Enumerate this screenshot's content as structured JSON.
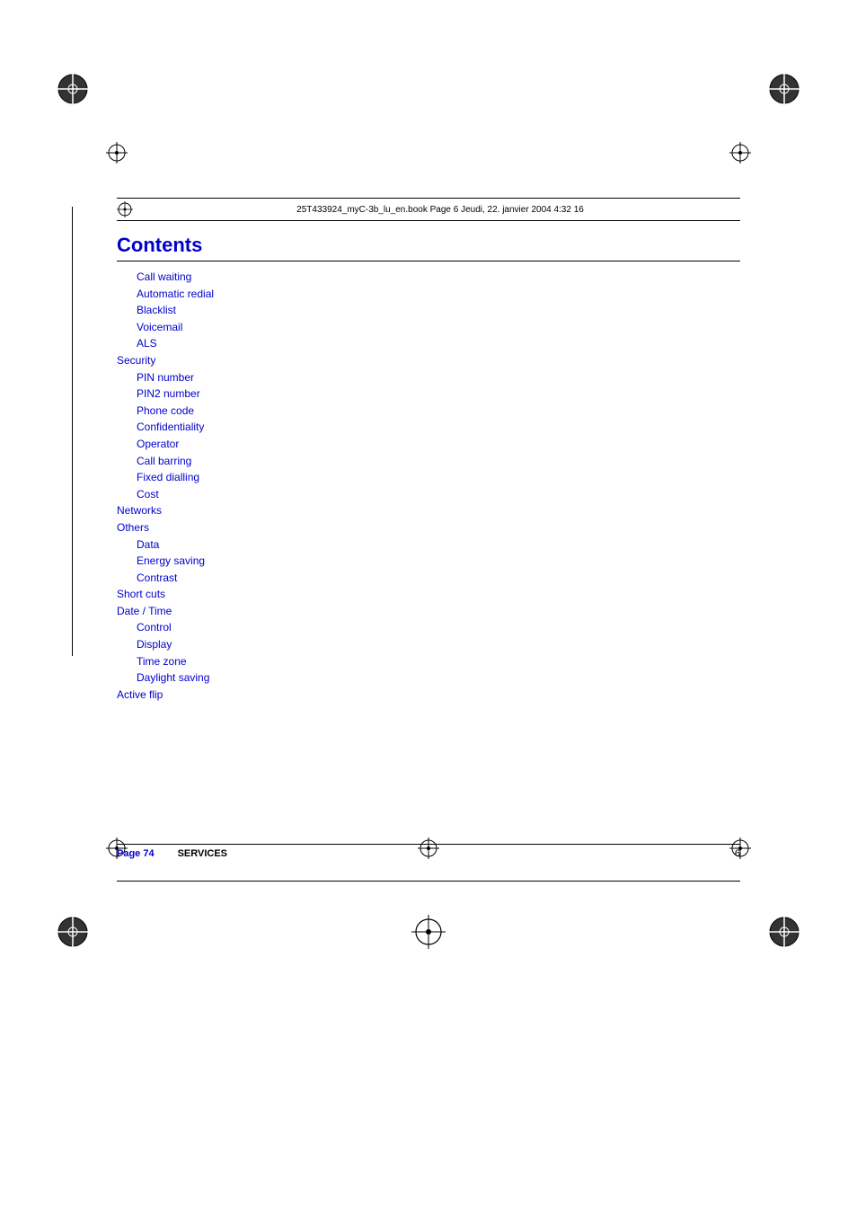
{
  "page": {
    "background": "#ffffff",
    "header": {
      "file_info": "25T433924_myC-3b_lu_en.book  Page 6  Jeudi, 22. janvier 2004  4:32 16"
    },
    "title": "Contents",
    "toc": [
      {
        "level": 2,
        "text": "Call waiting"
      },
      {
        "level": 2,
        "text": "Automatic redial"
      },
      {
        "level": 2,
        "text": "Blacklist"
      },
      {
        "level": 2,
        "text": "Voicemail"
      },
      {
        "level": 2,
        "text": "ALS"
      },
      {
        "level": 1,
        "text": "Security"
      },
      {
        "level": 2,
        "text": "PIN number"
      },
      {
        "level": 2,
        "text": "PIN2 number"
      },
      {
        "level": 2,
        "text": "Phone code"
      },
      {
        "level": 2,
        "text": "Confidentiality"
      },
      {
        "level": 2,
        "text": "Operator"
      },
      {
        "level": 2,
        "text": "Call barring"
      },
      {
        "level": 2,
        "text": "Fixed dialling"
      },
      {
        "level": 2,
        "text": "Cost"
      },
      {
        "level": 1,
        "text": "Networks"
      },
      {
        "level": 1,
        "text": "Others"
      },
      {
        "level": 2,
        "text": "Data"
      },
      {
        "level": 2,
        "text": "Energy saving"
      },
      {
        "level": 2,
        "text": "Contrast"
      },
      {
        "level": 1,
        "text": "Short cuts"
      },
      {
        "level": 1,
        "text": "Date / Time"
      },
      {
        "level": 2,
        "text": "Control"
      },
      {
        "level": 2,
        "text": "Display"
      },
      {
        "level": 2,
        "text": "Time zone"
      },
      {
        "level": 2,
        "text": "Daylight saving"
      },
      {
        "level": 1,
        "text": "Active flip"
      }
    ],
    "footer": {
      "page_label": "Page 74",
      "section": "SERVICES",
      "page_number": "6"
    }
  }
}
